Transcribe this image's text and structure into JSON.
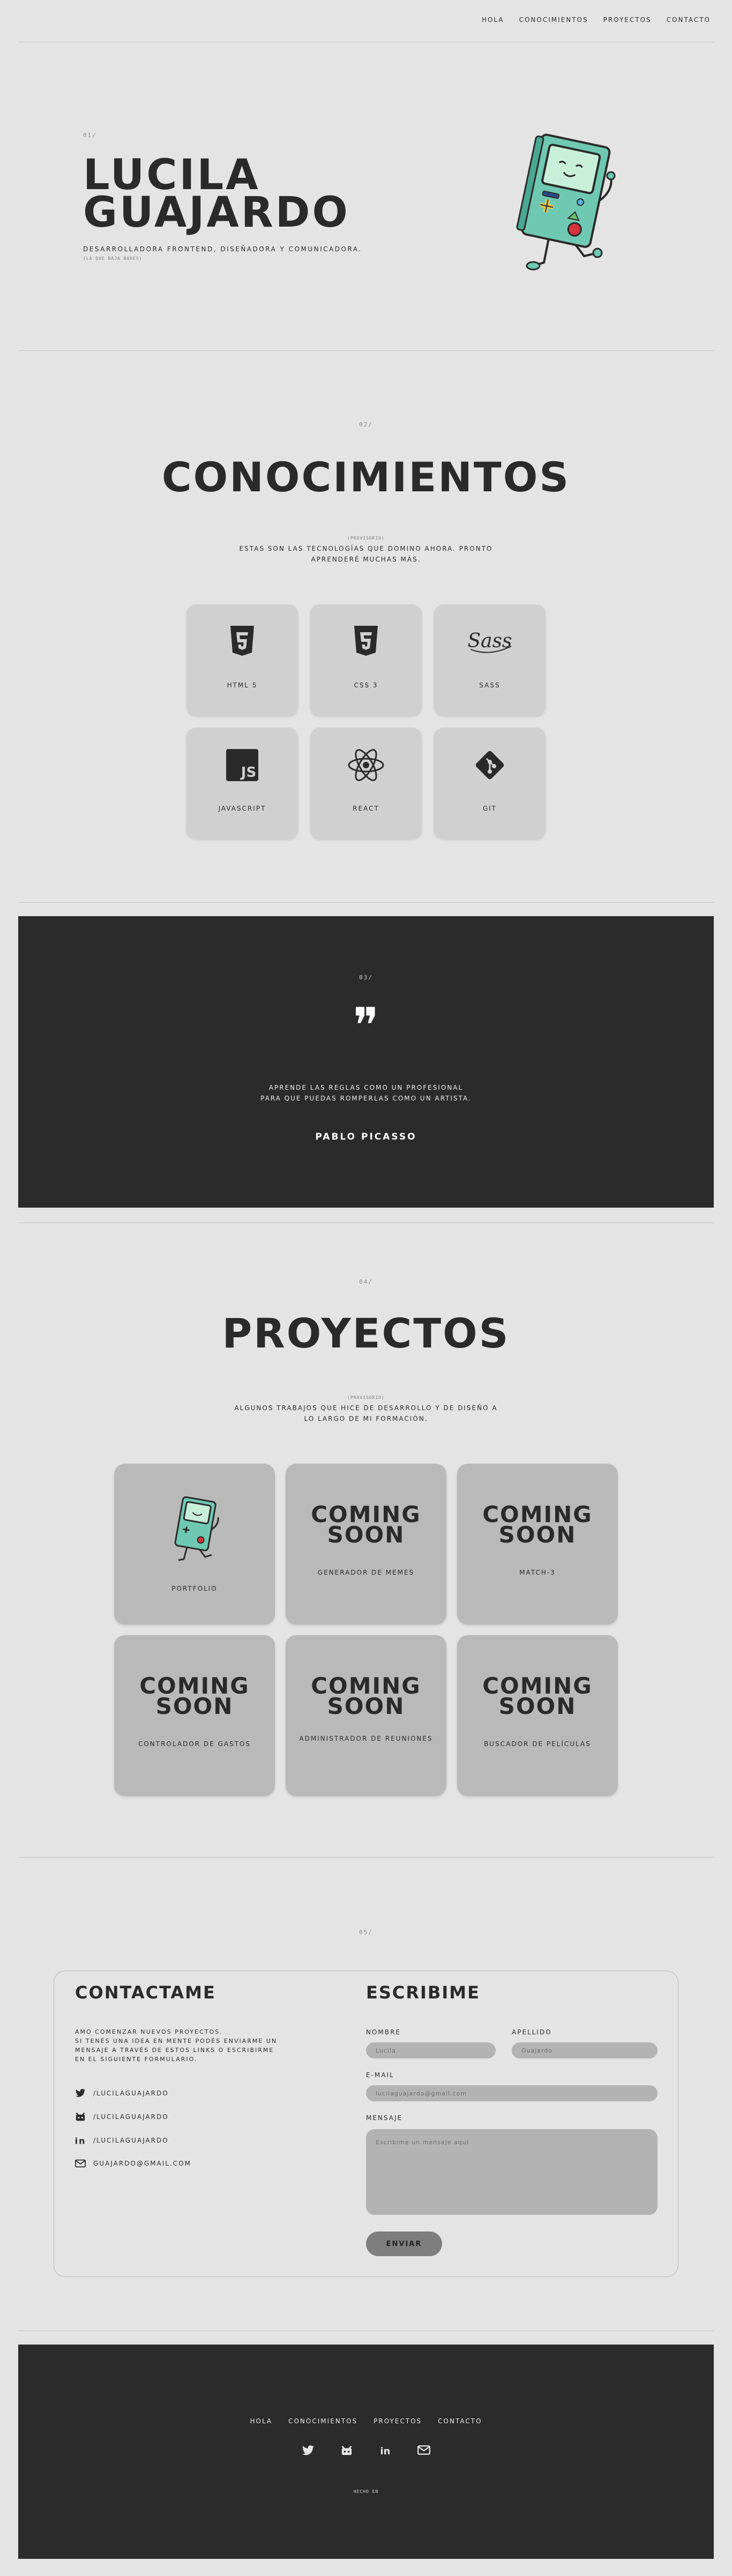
{
  "nav": {
    "items": [
      "HOLA",
      "CONOCIMIENTOS",
      "PROYECTOS",
      "CONTACTO"
    ]
  },
  "hero": {
    "number": "01/",
    "name_line1": "LUCILA",
    "name_line2": "GUAJARDO",
    "subtitle": "DESARROLLADORA FRONTEND, DISEÑADORA Y COMUNICADORA.",
    "tiny": "(LA QUE BAJA BARES)"
  },
  "skills": {
    "number": "02/",
    "title": "CONOCIMIENTOS",
    "tiny": "(PROVISORIO)",
    "desc_line1": "ESTAS SON LAS TECNOLOGÍAS QUE DOMINO AHORA. PRONTO",
    "desc_line2": "APRENDERÉ MUCHAS MÁS.",
    "items": [
      {
        "label": "HTML 5",
        "icon": "html5-icon"
      },
      {
        "label": "CSS 3",
        "icon": "css3-icon"
      },
      {
        "label": "SASS",
        "icon": "sass-icon"
      },
      {
        "label": "JAVASCRIPT",
        "icon": "javascript-icon"
      },
      {
        "label": "REACT",
        "icon": "react-icon"
      },
      {
        "label": "GIT",
        "icon": "git-icon"
      }
    ]
  },
  "quote": {
    "number": "03/",
    "mark": "❞",
    "line1": "APRENDE LAS REGLAS COMO UN PROFESIONAL",
    "line2": "PARA QUE PUEDAS ROMPERLAS COMO UN ARTISTA.",
    "author": "PABLO PICASSO"
  },
  "projects": {
    "number": "04/",
    "title": "PROYECTOS",
    "tiny": "(PROVISORIO)",
    "desc_line1": "ALGUNOS TRABAJOS QUE HICE DE DESARROLLO Y DE DISEÑO A",
    "desc_line2": "LO LARGO DE MI FORMACIÓN.",
    "coming_line1": "COMING",
    "coming_line2": "SOON",
    "items": [
      {
        "label": "PORTFOLIO"
      },
      {
        "label": "GENERADOR DE MEMES"
      },
      {
        "label": "MATCH-3"
      },
      {
        "label": "CONTROLADOR DE GASTOS"
      },
      {
        "label": "ADMINISTRADOR DE REUNIONES"
      },
      {
        "label": "BUSCADOR DE PELÍCULAS"
      }
    ]
  },
  "contact": {
    "number": "05/",
    "title_left": "CONTACTAME",
    "intro_line1": "AMO COMENZAR NUEVOS PROYECTOS.",
    "intro_line2": "SI TENÉS UNA IDEA EN MENTE PODÉS ENVIARME UN",
    "intro_line3": "MENSAJE A TRAVÉS DE ESTOS LINKS O ESCRIBIRME",
    "intro_line4": "EN EL SIGUIENTE FORMULARIO.",
    "socials": [
      {
        "icon": "twitter-icon",
        "text": "/LUCILAGUAJARDO"
      },
      {
        "icon": "github-icon",
        "text": "/LUCILAGUAJARDO"
      },
      {
        "icon": "linkedin-icon",
        "text": "/LUCILAGUAJARDO"
      },
      {
        "icon": "mail-icon",
        "text": "GUAJARDO@GMAIL.COM"
      }
    ],
    "title_right": "ESCRIBIME",
    "form": {
      "nombre_label": "NOMBRE",
      "nombre_placeholder": "Lucila",
      "apellido_label": "APELLIDO",
      "apellido_placeholder": "Guajardo",
      "email_label": "E-MAIL",
      "email_placeholder": "lucilaguajardo@gmail.com",
      "mensaje_label": "MENSAJE",
      "mensaje_placeholder": "Escribime un mensaje aquí",
      "submit": "ENVIAR"
    }
  },
  "footer": {
    "nav": [
      "HOLA",
      "CONOCIMIENTOS",
      "PROYECTOS",
      "CONTACTO"
    ],
    "credit": "HECHO EN"
  },
  "colors": {
    "background": "#e4e4e4",
    "dark": "#2b2b2b",
    "card": "#d0d0d0",
    "project_card": "#b9b9b9",
    "bmo_teal": "#6fc9b2"
  }
}
